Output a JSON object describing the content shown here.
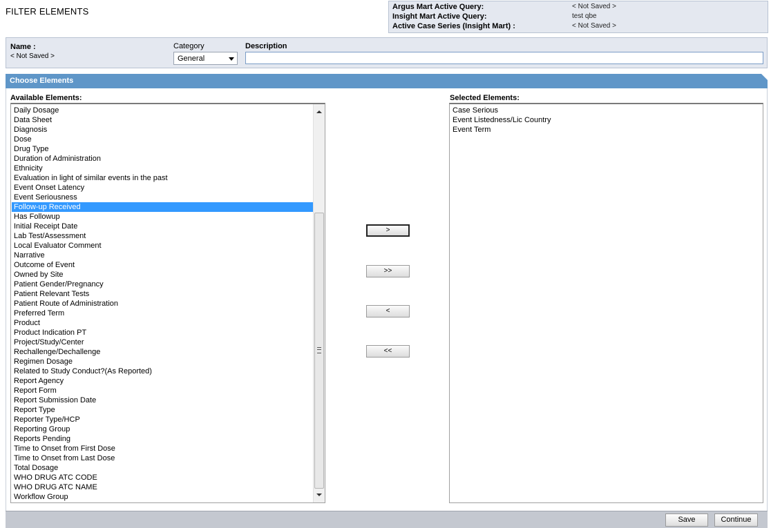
{
  "page": {
    "title": "FILTER ELEMENTS"
  },
  "query_info": {
    "argus_label": "Argus Mart Active Query:",
    "argus_value": "< Not Saved >",
    "insight_label": "Insight Mart Active Query:",
    "insight_value": "test qbe",
    "case_series_label": "Active Case Series (Insight Mart) :",
    "case_series_value": "< Not Saved >"
  },
  "filter": {
    "name_label": "Name :",
    "name_value": "< Not Saved >",
    "category_label": "Category",
    "category_value": "General",
    "description_label": "Description",
    "description_value": ""
  },
  "choose": {
    "header": "Choose Elements",
    "available_label": "Available Elements:",
    "selected_label": "Selected Elements:",
    "available_items": [
      "Daily Dosage",
      "Data Sheet",
      "Diagnosis",
      "Dose",
      "Drug Type",
      "Duration of Administration",
      "Ethnicity",
      "Evaluation in light of similar events in the past",
      "Event Onset Latency",
      "Event Seriousness",
      "Follow-up Received",
      "Has Followup",
      "Initial Receipt Date",
      "Lab Test/Assessment",
      "Local Evaluator Comment",
      "Narrative",
      "Outcome of Event",
      "Owned by Site",
      "Patient Gender/Pregnancy",
      "Patient Relevant Tests",
      "Patient Route of Administration",
      "Preferred Term",
      "Product",
      "Product Indication PT",
      "Project/Study/Center",
      "Rechallenge/Dechallenge",
      "Regimen Dosage",
      "Related to Study Conduct?(As Reported)",
      "Report Agency",
      "Report Form",
      "Report Submission Date",
      "Report Type",
      "Reporter Type/HCP",
      "Reporting Group",
      "Reports Pending",
      "Time to Onset from First Dose",
      "Time to Onset from Last Dose",
      "Total Dosage",
      "WHO DRUG ATC CODE",
      "WHO DRUG ATC NAME",
      "Workflow Group"
    ],
    "highlighted_item": "Follow-up Received",
    "selected_items": [
      "Case Serious",
      "Event Listedness/Lic Country",
      "Event Term"
    ],
    "buttons": {
      "add": ">",
      "add_all": ">>",
      "remove": "<",
      "remove_all": "<<"
    }
  },
  "footer": {
    "save_label": "Save",
    "continue_label": "Continue"
  },
  "colors": {
    "header_bar": "#5f96c8",
    "selection": "#3399ff",
    "panel_bg": "#e4e8f0",
    "footer_bg": "#c4c8d0"
  }
}
